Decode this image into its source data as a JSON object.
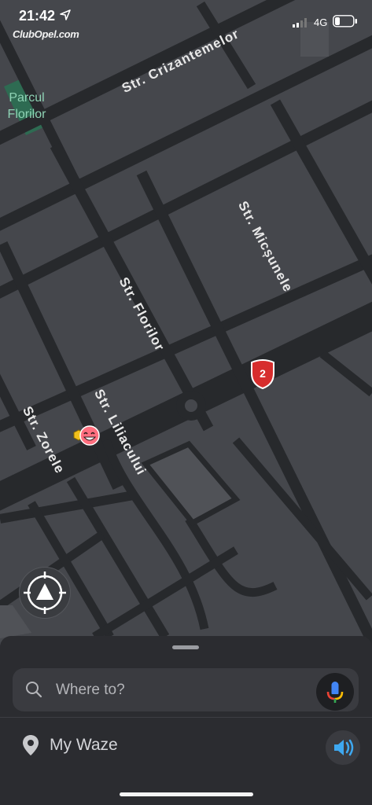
{
  "status_bar": {
    "time": "21:42",
    "watermark": "ClubOpel.com",
    "network": "4G"
  },
  "map": {
    "streets": {
      "crizantemelor": "Str. Crizantemelor",
      "micsunele": "Str. Micșunele",
      "florilor": "Str. Florilor",
      "liliacului": "Str. Liliacului",
      "zorele": "Str. Zorele"
    },
    "park": "Parcul\nFlorilor",
    "route_shield": "2",
    "colors": {
      "road": "#27292c",
      "block": "#45474c",
      "park": "#2e6b52",
      "shield": "#d72d2d"
    }
  },
  "bottom_sheet": {
    "search_placeholder": "Where to?",
    "my_waze": "My Waze"
  }
}
